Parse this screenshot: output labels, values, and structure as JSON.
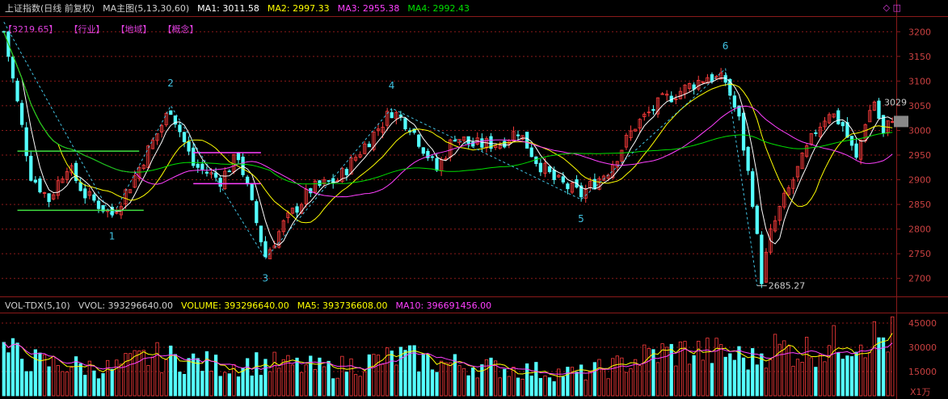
{
  "main_header": {
    "title": "上证指数(日线 前复权)",
    "indicator": "MA主图(5,13,30,60)",
    "ma1": "MA1: 3011.58",
    "ma2": "MA2: 2997.33",
    "ma3": "MA3: 2955.38",
    "ma4": "MA4: 2992.43"
  },
  "tag_line": {
    "first": "【3219.65】",
    "items": [
      "【行业】",
      "【地域】",
      "【概念】"
    ]
  },
  "right_icons": "◇ ◫",
  "vol_header": {
    "indicator": "VOL-TDX(5,10)",
    "vvol": "VVOL: 393296640.00",
    "volume": "VOLUME: 393296640.00",
    "ma5": "MA5: 393736608.00",
    "ma10": "MA10: 396691456.00"
  },
  "colors": {
    "up": "#ff3c3c",
    "down": "#54ffff",
    "ma1": "#ffffff",
    "ma2": "#ffff00",
    "ma3": "#ff40ff",
    "ma4": "#00e000",
    "wave": "#40c0e0",
    "grid": "#8a1a1a",
    "axis_text": "#c84040"
  },
  "chart_data": {
    "type": "candlestick",
    "price_axis": {
      "ticks": [
        3200,
        3150,
        3100,
        3050,
        3000,
        2950,
        2900,
        2850,
        2800,
        2750,
        2700
      ],
      "ylim": [
        2675,
        3225
      ]
    },
    "volume_axis": {
      "ticks": [
        45000,
        30000,
        15000
      ],
      "unit": "X1万",
      "ylim": [
        0,
        50000
      ]
    },
    "annotations": {
      "max_label": "3219.65",
      "min_label": "2685.27",
      "last_label": "3029",
      "wave_labels": [
        "1",
        "2",
        "3",
        "4",
        "5",
        "6"
      ]
    },
    "wave_points": [
      {
        "i": 0,
        "v": 3219.65
      },
      {
        "i": 24,
        "v": 2825
      },
      {
        "i": 37,
        "v": 3050
      },
      {
        "i": 58,
        "v": 2740
      },
      {
        "i": 86,
        "v": 3045
      },
      {
        "i": 128,
        "v": 2860
      },
      {
        "i": 160,
        "v": 3125
      },
      {
        "i": 167,
        "v": 2685.27
      }
    ],
    "support_lines": [
      {
        "color": "#40e040",
        "i0": 3,
        "i1": 30,
        "v": 2958
      },
      {
        "color": "#40e040",
        "i0": 3,
        "i1": 31,
        "v": 2838
      },
      {
        "color": "#ff40ff",
        "i0": 42,
        "i1": 57,
        "v": 2955
      },
      {
        "color": "#ff40ff",
        "i0": 42,
        "i1": 57,
        "v": 2892
      }
    ],
    "close_keyframes": [
      [
        0,
        3200
      ],
      [
        6,
        2910
      ],
      [
        10,
        2860
      ],
      [
        14,
        2930
      ],
      [
        18,
        2870
      ],
      [
        24,
        2830
      ],
      [
        28,
        2890
      ],
      [
        32,
        2960
      ],
      [
        37,
        3045
      ],
      [
        42,
        2930
      ],
      [
        48,
        2900
      ],
      [
        52,
        2950
      ],
      [
        58,
        2745
      ],
      [
        62,
        2810
      ],
      [
        68,
        2880
      ],
      [
        74,
        2900
      ],
      [
        80,
        2970
      ],
      [
        86,
        3040
      ],
      [
        90,
        3010
      ],
      [
        96,
        2920
      ],
      [
        100,
        2990
      ],
      [
        104,
        2970
      ],
      [
        110,
        2975
      ],
      [
        114,
        3000
      ],
      [
        118,
        2940
      ],
      [
        122,
        2900
      ],
      [
        128,
        2870
      ],
      [
        134,
        2920
      ],
      [
        140,
        3010
      ],
      [
        146,
        3060
      ],
      [
        152,
        3090
      ],
      [
        156,
        3110
      ],
      [
        160,
        3100
      ],
      [
        163,
        3020
      ],
      [
        166,
        2860
      ],
      [
        168,
        2700
      ],
      [
        170,
        2790
      ],
      [
        172,
        2840
      ],
      [
        176,
        2920
      ],
      [
        180,
        3000
      ],
      [
        183,
        3040
      ],
      [
        186,
        3010
      ],
      [
        189,
        2940
      ],
      [
        191,
        3020
      ],
      [
        193,
        3060
      ],
      [
        195,
        2990
      ],
      [
        197,
        3029
      ]
    ],
    "volume_keyframes": [
      [
        0,
        30000
      ],
      [
        8,
        22000
      ],
      [
        16,
        20000
      ],
      [
        24,
        18000
      ],
      [
        32,
        26000
      ],
      [
        40,
        24000
      ],
      [
        48,
        20000
      ],
      [
        56,
        22000
      ],
      [
        64,
        20000
      ],
      [
        72,
        18000
      ],
      [
        80,
        22000
      ],
      [
        88,
        26000
      ],
      [
        96,
        22000
      ],
      [
        104,
        20000
      ],
      [
        112,
        18000
      ],
      [
        120,
        16000
      ],
      [
        128,
        15000
      ],
      [
        136,
        20000
      ],
      [
        144,
        28000
      ],
      [
        152,
        30000
      ],
      [
        160,
        28000
      ],
      [
        166,
        24000
      ],
      [
        170,
        33000
      ],
      [
        176,
        30000
      ],
      [
        182,
        32000
      ],
      [
        186,
        36000
      ],
      [
        190,
        40000
      ],
      [
        194,
        38000
      ],
      [
        197,
        39000
      ]
    ],
    "n_bars": 198
  }
}
